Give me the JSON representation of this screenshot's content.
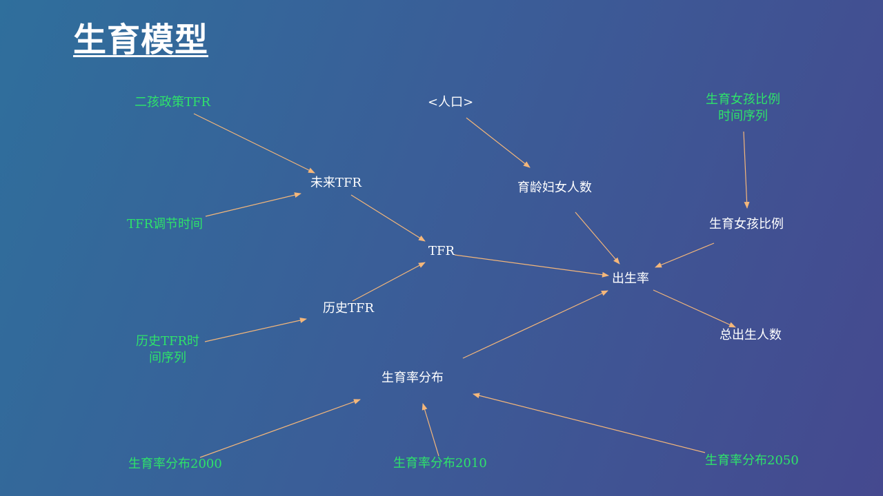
{
  "title": "生育模型",
  "nodes": {
    "second_child_tfr": "二孩政策TFR",
    "population": "<人口>",
    "girl_ratio_series_line1": "生育女孩比例",
    "girl_ratio_series_line2": "时间序列",
    "future_tfr": "未来TFR",
    "women_childbearing_age": "育龄妇女人数",
    "tfr_adjust_time": "TFR调节时间",
    "girl_ratio": "生育女孩比例",
    "tfr": "TFR",
    "birth_rate": "出生率",
    "historical_tfr": "历史TFR",
    "total_births": "总出生人数",
    "historical_tfr_series_line1": "历史TFR时",
    "historical_tfr_series_line2": "间序列",
    "fertility_distribution": "生育率分布",
    "fertility_dist_2000": "生育率分布2000",
    "fertility_dist_2010": "生育率分布2010",
    "fertility_dist_2050": "生育率分布2050"
  },
  "colors": {
    "node_white": "#ffffff",
    "node_green": "#2ee36a",
    "arrow": "#f5b77a"
  }
}
